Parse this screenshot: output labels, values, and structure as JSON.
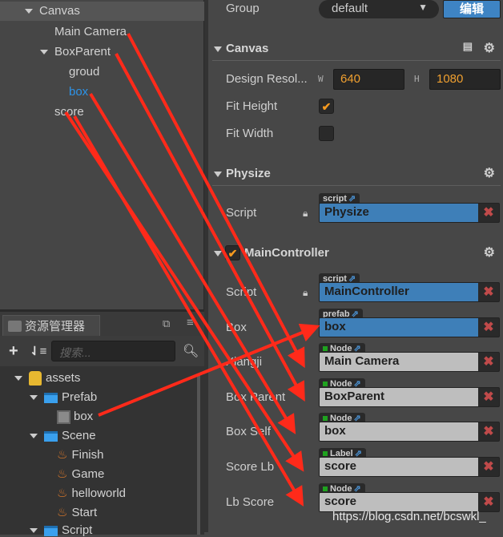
{
  "hierarchy": {
    "items": [
      {
        "label": "Canvas",
        "expanded": true,
        "selected": true
      },
      {
        "label": "Main Camera"
      },
      {
        "label": "BoxParent",
        "expanded": true
      },
      {
        "label": "groud"
      },
      {
        "label": "box",
        "highlighted": true
      },
      {
        "label": "score"
      }
    ]
  },
  "assets": {
    "tab_label": "资源管理器",
    "search_placeholder": "搜索...",
    "tree": [
      {
        "label": "assets",
        "icon": "asset-db-icon"
      },
      {
        "label": "Prefab",
        "icon": "folder-icon"
      },
      {
        "label": "box",
        "icon": "prefab-icon"
      },
      {
        "label": "Scene",
        "icon": "folder-icon"
      },
      {
        "label": "Finish",
        "icon": "scene-fire-icon"
      },
      {
        "label": "Game",
        "icon": "scene-fire-icon"
      },
      {
        "label": "helloworld",
        "icon": "scene-fire-icon"
      },
      {
        "label": "Start",
        "icon": "scene-fire-icon"
      },
      {
        "label": "Script",
        "icon": "folder-icon"
      }
    ]
  },
  "inspector": {
    "group_label": "Group",
    "group_value": "default",
    "edit_button": "编辑",
    "canvas": {
      "title": "Canvas",
      "design_label": "Design Resol...",
      "w_label": "W",
      "w_value": "640",
      "h_label": "H",
      "h_value": "1080",
      "fit_height_label": "Fit Height",
      "fit_height": true,
      "fit_width_label": "Fit Width",
      "fit_width": false
    },
    "physize": {
      "title": "Physize",
      "script_label": "Script",
      "script_tag": "script",
      "script_value": "Physize"
    },
    "main_controller": {
      "title": "MainController",
      "enabled": true,
      "props": [
        {
          "label": "Script",
          "tag": "script",
          "value": "MainController",
          "style": "blue"
        },
        {
          "label": "Box",
          "tag": "prefab",
          "value": "box",
          "style": "blue"
        },
        {
          "label": "Xiangji",
          "tag": "Node",
          "value": "Main Camera",
          "style": "gray"
        },
        {
          "label": "Box Parent",
          "tag": "Node",
          "value": "BoxParent",
          "style": "gray"
        },
        {
          "label": "Box Self",
          "tag": "Node",
          "value": "box",
          "style": "gray"
        },
        {
          "label": "Score Lb",
          "tag": "Label",
          "value": "score",
          "style": "gray"
        },
        {
          "label": "Lb Score",
          "tag": "Node",
          "value": "score",
          "style": "gray"
        }
      ]
    }
  },
  "watermark": "https://blog.csdn.net/bcswkl_",
  "colors": {
    "accent_blue": "#3e7fb8",
    "annotation_red": "#ff2a1a",
    "checkbox_orange": "#f59a1f"
  }
}
